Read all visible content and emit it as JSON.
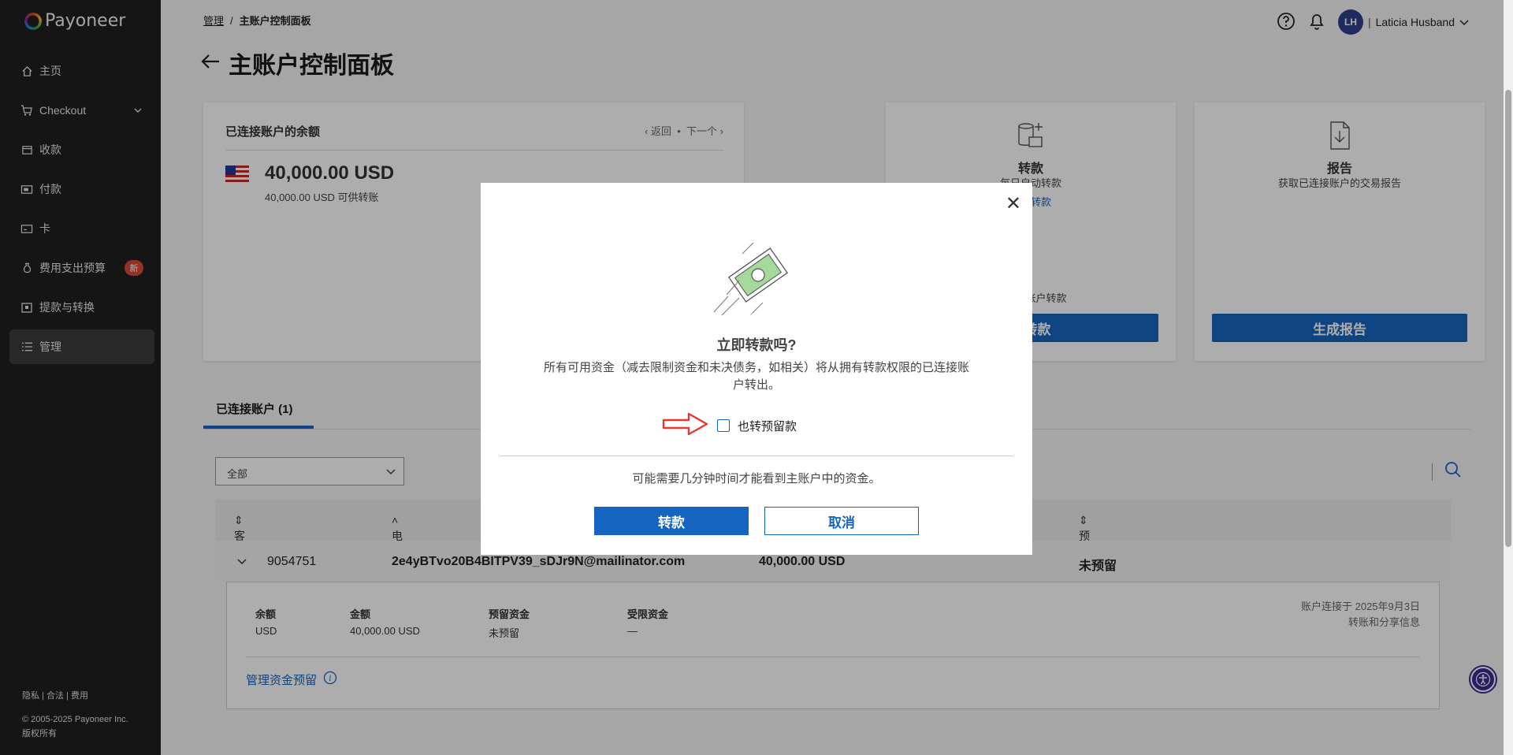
{
  "brand": {
    "name": "Payoneer"
  },
  "sidebar": {
    "items": [
      {
        "label": "主页",
        "icon": "home-icon"
      },
      {
        "label": "Checkout",
        "icon": "cart-icon"
      },
      {
        "label": "收款",
        "icon": "wallet-icon"
      },
      {
        "label": "付款",
        "icon": "payment-icon"
      },
      {
        "label": "卡",
        "icon": "card-icon"
      },
      {
        "label": "费用支出预算",
        "icon": "budget-icon",
        "badge": "新"
      },
      {
        "label": "提款与转换",
        "icon": "withdraw-icon"
      },
      {
        "label": "管理",
        "icon": "list-icon",
        "active": true
      }
    ],
    "footer_links": [
      "隐私",
      "合法",
      "费用"
    ],
    "copyright_line1": "© 2005-2025 Payoneer Inc.",
    "copyright_line2": "版权所有"
  },
  "header": {
    "breadcrumb_parent": "管理",
    "breadcrumb_sep": "/",
    "breadcrumb_current": "主账户控制面板",
    "page_title": "主账户控制面板",
    "user_initials": "LH",
    "user_name": "Laticia Husband"
  },
  "balance_card": {
    "title": "已连接账户的余额",
    "prev": "返回",
    "next": "下一个",
    "amount": "40,000.00 USD",
    "available": "40,000.00 USD 可供转账"
  },
  "transfer_card": {
    "title": "转款",
    "desc": "每日自动转款",
    "link": "自动转款",
    "note": "连接的账户转款",
    "button": "即转款"
  },
  "report_card": {
    "title": "报告",
    "desc": "获取已连接账户的交易报告",
    "button": "生成报告"
  },
  "tabs": {
    "connected": "已连接账户 (1)"
  },
  "filter": {
    "value": "全部"
  },
  "table": {
    "headers": {
      "customer_id": "客户 ID",
      "email": "电子邮箱",
      "reserve": "预留资金"
    },
    "row": {
      "customer_id": "9054751",
      "email": "2e4yBTvo20B4BITPV39_sDJr9N@mailinator.com",
      "balance": "40,000.00 USD",
      "reserve": "未预留"
    },
    "detail": {
      "labels": {
        "balance": "余额",
        "amount": "金额",
        "reserve": "预留资金",
        "restricted": "受限资金"
      },
      "values": {
        "currency": "USD",
        "amount": "40,000.00 USD",
        "reserve": "未预留",
        "restricted": "—"
      },
      "connected_on": "账户连接于 2025年9月3日",
      "share_info": "转账和分享信息",
      "manage_link": "管理资金预留"
    }
  },
  "modal": {
    "title": "立即转款吗?",
    "text": "所有可用资金（减去限制资金和未决债务，如相关）将从拥有转款权限的已连接账户转出。",
    "checkbox_label": "也转预留款",
    "note": "可能需要几分钟时间才能看到主账户中的资金。",
    "confirm": "转款",
    "cancel": "取消"
  },
  "colors": {
    "primary": "#1565c0",
    "sidebar_bg": "#1f1f1f",
    "arrow_red": "#e53935",
    "badge": "#d84a3a"
  }
}
